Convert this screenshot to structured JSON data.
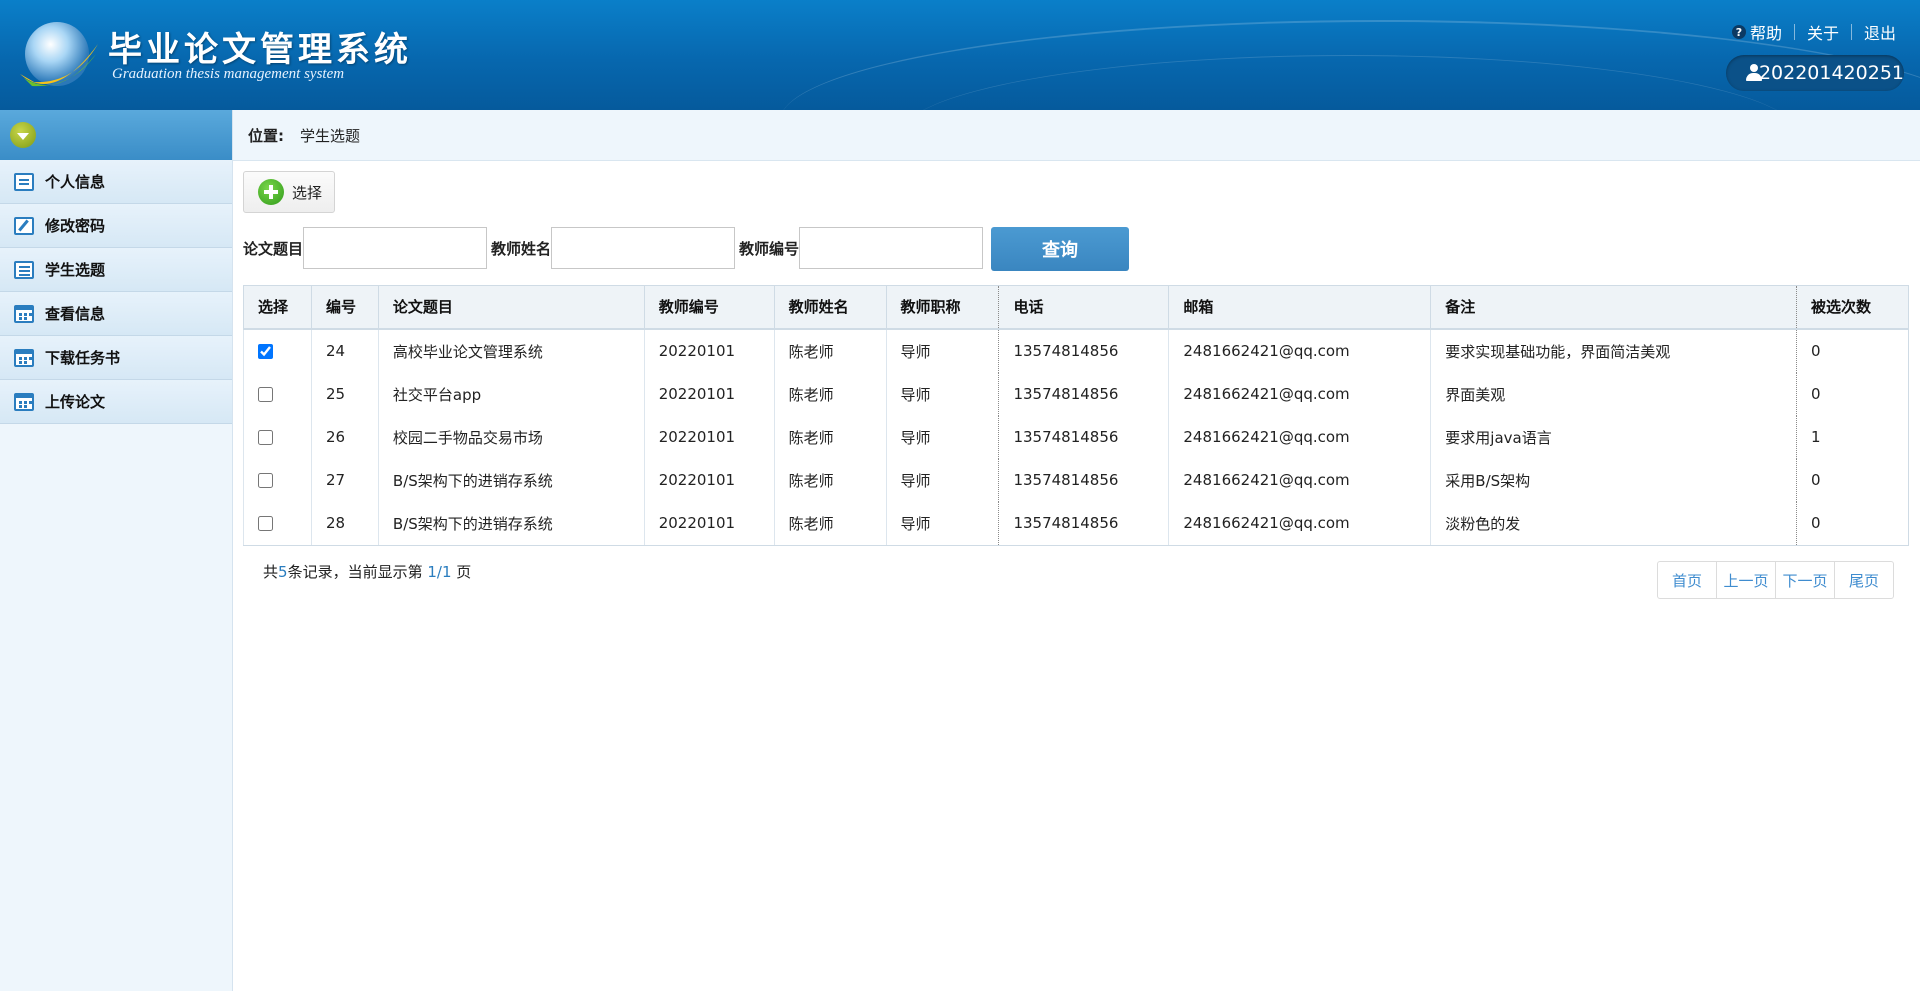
{
  "header": {
    "title": "毕业论文管理系统",
    "subtitle": "Graduation thesis management system",
    "links": [
      {
        "label": "帮助",
        "icon": "help-icon"
      },
      {
        "label": "关于"
      },
      {
        "label": "退出"
      }
    ],
    "user": "202201420251"
  },
  "sidebar": {
    "items": [
      {
        "label": "个人信息",
        "icon": "message-icon"
      },
      {
        "label": "修改密码",
        "icon": "edit-icon"
      },
      {
        "label": "学生选题",
        "icon": "list-icon"
      },
      {
        "label": "查看信息",
        "icon": "calendar-icon"
      },
      {
        "label": "下载任务书",
        "icon": "calendar-icon"
      },
      {
        "label": "上传论文",
        "icon": "calendar-icon"
      }
    ]
  },
  "breadcrumb": {
    "label": "位置:",
    "current": "学生选题"
  },
  "toolbar": {
    "select_label": "选择"
  },
  "search": {
    "fields": [
      {
        "label": "论文题目",
        "value": ""
      },
      {
        "label": "教师姓名",
        "value": ""
      },
      {
        "label": "教师编号",
        "value": ""
      }
    ],
    "button_label": "查询"
  },
  "table": {
    "headers": [
      "选择",
      "编号",
      "论文题目",
      "教师编号",
      "教师姓名",
      "教师职称",
      "电话",
      "邮箱",
      "备注",
      "被选次数"
    ],
    "rows": [
      {
        "checked": true,
        "cells": [
          "24",
          "高校毕业论文管理系统",
          "20220101",
          "陈老师",
          "导师",
          "13574814856",
          "2481662421@qq.com",
          "要求实现基础功能，界面简洁美观",
          "0"
        ]
      },
      {
        "checked": false,
        "cells": [
          "25",
          "社交平台app",
          "20220101",
          "陈老师",
          "导师",
          "13574814856",
          "2481662421@qq.com",
          "界面美观",
          "0"
        ]
      },
      {
        "checked": false,
        "cells": [
          "26",
          "校园二手物品交易市场",
          "20220101",
          "陈老师",
          "导师",
          "13574814856",
          "2481662421@qq.com",
          "要求用java语言",
          "1"
        ]
      },
      {
        "checked": false,
        "cells": [
          "27",
          "B/S架构下的进销存系统",
          "20220101",
          "陈老师",
          "导师",
          "13574814856",
          "2481662421@qq.com",
          "采用B/S架构",
          "0"
        ]
      },
      {
        "checked": false,
        "cells": [
          "28",
          "B/S架构下的进销存系统",
          "20220101",
          "陈老师",
          "导师",
          "13574814856",
          "2481662421@qq.com",
          "淡粉色的发",
          "0"
        ]
      }
    ]
  },
  "footer": {
    "prefix": "共",
    "count": "5",
    "mid": "条记录，当前显示第 ",
    "page": "1/1",
    "suffix": " 页"
  },
  "pager": [
    "首页",
    "上一页",
    "下一页",
    "尾页"
  ],
  "colors": {
    "header": "#0767ae",
    "accent": "#2a7dbf",
    "query_button": "#3f8ccf"
  }
}
